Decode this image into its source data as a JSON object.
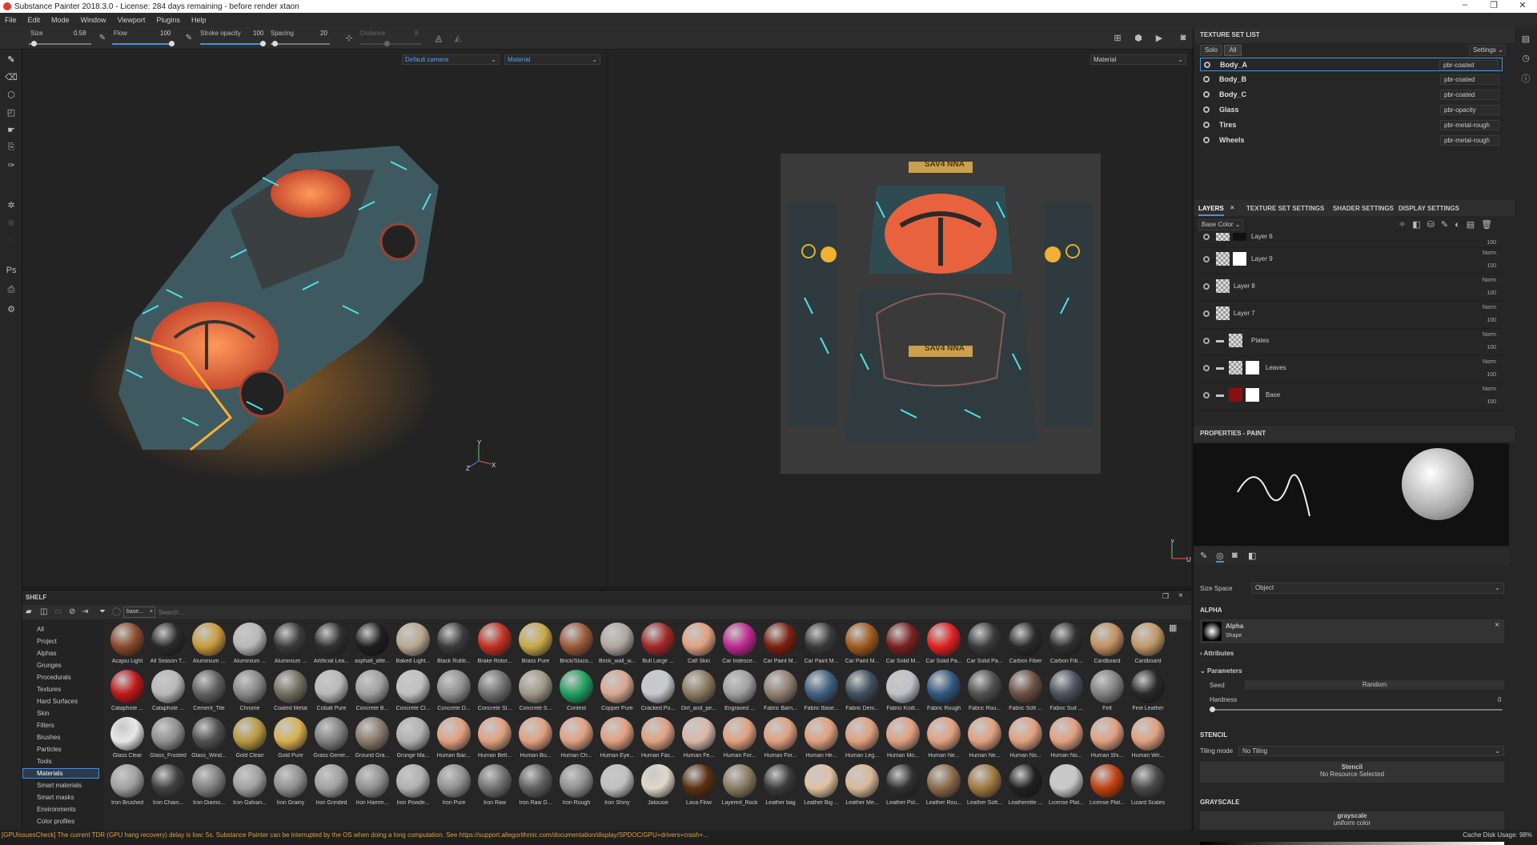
{
  "window": {
    "title": "Substance Painter 2018.3.0 - License: 284 days remaining - before render xtaon"
  },
  "menu": [
    "File",
    "Edit",
    "Mode",
    "Window",
    "Viewport",
    "Plugins",
    "Help"
  ],
  "toolbar": {
    "size_label": "Size",
    "size_value": "0.58",
    "flow_label": "Flow",
    "flow_value": "100",
    "stroke_label": "Stroke opacity",
    "stroke_value": "100",
    "spacing_label": "Spacing",
    "spacing_value": "20",
    "distance_label": "Distance",
    "distance_value": "8"
  },
  "viewport3d": {
    "camera": "Default camera",
    "mode": "Material"
  },
  "viewport2d": {
    "mode": "Material",
    "plate_text": "SAV4 NNA"
  },
  "texture_set_list": {
    "title": "TEXTURE SET LIST",
    "solo": "Solo",
    "all": "All",
    "settings": "Settings",
    "items": [
      {
        "name": "Body_A",
        "shader": "pbr-coated"
      },
      {
        "name": "Body_B",
        "shader": "pbr-coated"
      },
      {
        "name": "Body_C",
        "shader": "pbr-coated"
      },
      {
        "name": "Glass",
        "shader": "pbr-opacity"
      },
      {
        "name": "Tires",
        "shader": "pbr-metal-rough"
      },
      {
        "name": "Wheels",
        "shader": "pbr-metal-rough"
      }
    ]
  },
  "layers_tabs": [
    "LAYERS",
    "TEXTURE SET SETTINGS",
    "SHADER SETTINGS",
    "DISPLAY SETTINGS"
  ],
  "layers": {
    "channel": "Base Color",
    "items": [
      {
        "name": "Layer 6",
        "blend": "",
        "opacity": "100"
      },
      {
        "name": "Layer 9",
        "blend": "Norm",
        "opacity": "100"
      },
      {
        "name": "Layer 8",
        "blend": "Norm",
        "opacity": "100"
      },
      {
        "name": "Layer 7",
        "blend": "Norm",
        "opacity": "100"
      },
      {
        "name": "Plates",
        "blend": "Norm",
        "opacity": "100"
      },
      {
        "name": "Leaves",
        "blend": "Norm",
        "opacity": "100"
      },
      {
        "name": "Base",
        "blend": "Norm",
        "opacity": "100"
      }
    ]
  },
  "properties": {
    "title": "PROPERTIES - PAINT",
    "size_space_label": "Size Space",
    "size_space_value": "Object",
    "alpha_header": "ALPHA",
    "alpha_name": "Alpha",
    "alpha_sub": "Shape",
    "attributes": "Attributes",
    "parameters": "Parameters",
    "seed_label": "Seed",
    "seed_value": "Random",
    "hardness_label": "Hardness",
    "hardness_value": "0",
    "stencil_header": "STENCIL",
    "tiling_label": "Tiling mode",
    "tiling_value": "No Tiling",
    "stencil_title": "Stencil",
    "stencil_sub": "No Resource Selected",
    "grayscale_header": "GRAYSCALE",
    "grayscale_title": "grayscale",
    "grayscale_sub": "uniform color",
    "grayscale_value": "1"
  },
  "shelf": {
    "title": "SHELF",
    "filter_tag": "base...",
    "search_placeholder": "Search...",
    "categories": [
      "All",
      "Project",
      "Alphas",
      "Grunges",
      "Procedurals",
      "Textures",
      "Hard Surfaces",
      "Skin",
      "Filters",
      "Brushes",
      "Particles",
      "Tools",
      "Materials",
      "Smart materials",
      "Smart masks",
      "Environments",
      "Color profiles"
    ],
    "selected_category": "Materials",
    "materials": [
      {
        "n": "Acajou Light",
        "c": "#8a4a2a"
      },
      {
        "n": "All Season T...",
        "c": "#2a2a2a"
      },
      {
        "n": "Aluminium ...",
        "c": "#c89a3a"
      },
      {
        "n": "Aluminium ...",
        "c": "#b8b8b8"
      },
      {
        "n": "Aluminium ...",
        "c": "#3a3a3a"
      },
      {
        "n": "Artificial Lea...",
        "c": "#303030"
      },
      {
        "n": "asphalt_afte...",
        "c": "#1e1e1e"
      },
      {
        "n": "Baked Light...",
        "c": "#b8a890"
      },
      {
        "n": "Black Rubb...",
        "c": "#3a3a3a"
      },
      {
        "n": "Brake Rotor...",
        "c": "#c03020"
      },
      {
        "n": "Brass Pure",
        "c": "#c8a848"
      },
      {
        "n": "Brick/Stuco...",
        "c": "#9a5a3a"
      },
      {
        "n": "Brick_wall_w...",
        "c": "#b0a8a0"
      },
      {
        "n": "Bull Large ...",
        "c": "#a02828"
      },
      {
        "n": "Calf Skin",
        "c": "#e0a080"
      },
      {
        "n": "Car Iridesce...",
        "c": "#c02890"
      },
      {
        "n": "Car Paint M...",
        "c": "#7a2010"
      },
      {
        "n": "Car Paint M...",
        "c": "#3a3a3a"
      },
      {
        "n": "Car Paint M...",
        "c": "#a05a20"
      },
      {
        "n": "Car Solid M...",
        "c": "#7a2020"
      },
      {
        "n": "Car Solid Pa...",
        "c": "#e02020"
      },
      {
        "n": "Car Solid Pa...",
        "c": "#3a3a3a"
      },
      {
        "n": "Carbon Fiber",
        "c": "#2a2a2a"
      },
      {
        "n": "Carbon Fib...",
        "c": "#303030"
      },
      {
        "n": "Cardboard",
        "c": "#c09060"
      },
      {
        "n": "Cardboard",
        "c": "#c09868"
      },
      {
        "n": "Cataphote ...",
        "c": "#c01818"
      },
      {
        "n": "Cataphote ...",
        "c": "#b8b8b8"
      },
      {
        "n": "Cement_Tile",
        "c": "#606060"
      },
      {
        "n": "Chrome",
        "c": "#888"
      },
      {
        "n": "Coated Metal",
        "c": "#707060"
      },
      {
        "n": "Cobalt Pure",
        "c": "#b8b8b8"
      },
      {
        "n": "Concrete B...",
        "c": "#a0a0a0"
      },
      {
        "n": "Concrete Cl...",
        "c": "#c0c0c0"
      },
      {
        "n": "Concrete D...",
        "c": "#909090"
      },
      {
        "n": "Concrete Sl...",
        "c": "#707070"
      },
      {
        "n": "Concrete S...",
        "c": "#a09888"
      },
      {
        "n": "Contest",
        "c": "#20a060"
      },
      {
        "n": "Copper Pure",
        "c": "#d8a890"
      },
      {
        "n": "Cracked Po...",
        "c": "#c8c8d0"
      },
      {
        "n": "Dirt_and_pe...",
        "c": "#8a7a60"
      },
      {
        "n": "Engraved ...",
        "c": "#a0a0a0"
      },
      {
        "n": "Fabric Barn...",
        "c": "#908070"
      },
      {
        "n": "Fabric Base...",
        "c": "#406080"
      },
      {
        "n": "Fabric Deni...",
        "c": "#405060"
      },
      {
        "n": "Fabric Knitt...",
        "c": "#c0c0c8"
      },
      {
        "n": "Fabric Rough",
        "c": "#305880"
      },
      {
        "n": "Fabric Rou...",
        "c": "#505050"
      },
      {
        "n": "Fabric Soft ...",
        "c": "#6a5040"
      },
      {
        "n": "Fabric Suit ...",
        "c": "#505060"
      },
      {
        "n": "Felt",
        "c": "#808080"
      },
      {
        "n": "Fine Leather",
        "c": "#282828"
      },
      {
        "n": "Glass Clear",
        "c": "#e8e8e8"
      },
      {
        "n": "Glass_Frosted",
        "c": "#909090"
      },
      {
        "n": "Glass_Wind...",
        "c": "#505050"
      },
      {
        "n": "Gold Clean",
        "c": "#b89840"
      },
      {
        "n": "Gold Pure",
        "c": "#d8b050"
      },
      {
        "n": "Grass Gener...",
        "c": "#808080"
      },
      {
        "n": "Ground Gra...",
        "c": "#8a7a6a"
      },
      {
        "n": "Grunge Ma...",
        "c": "#b0b0b0"
      },
      {
        "n": "Human Bac...",
        "c": "#e0a080"
      },
      {
        "n": "Human Bell...",
        "c": "#e0a080"
      },
      {
        "n": "Human Bu...",
        "c": "#e0a080"
      },
      {
        "n": "Human Ch...",
        "c": "#e0a080"
      },
      {
        "n": "Human Eye...",
        "c": "#e0a080"
      },
      {
        "n": "Human Fac...",
        "c": "#e0a080"
      },
      {
        "n": "Human Fe...",
        "c": "#d8b8a8"
      },
      {
        "n": "Human For...",
        "c": "#e0a080"
      },
      {
        "n": "Human For...",
        "c": "#e0a080"
      },
      {
        "n": "Human He...",
        "c": "#e0a080"
      },
      {
        "n": "Human Leg...",
        "c": "#e0a080"
      },
      {
        "n": "Human Mo...",
        "c": "#e0a080"
      },
      {
        "n": "Human Ne...",
        "c": "#e0a080"
      },
      {
        "n": "Human Ne...",
        "c": "#e0a080"
      },
      {
        "n": "Human No...",
        "c": "#e0a080"
      },
      {
        "n": "Human No...",
        "c": "#e0a080"
      },
      {
        "n": "Human Shi...",
        "c": "#e0a080"
      },
      {
        "n": "Human Wri...",
        "c": "#e0a080"
      },
      {
        "n": "Iron Brushed",
        "c": "#a0a0a0"
      },
      {
        "n": "Iron Chain...",
        "c": "#404040"
      },
      {
        "n": "Iron Diamo...",
        "c": "#808080"
      },
      {
        "n": "Iron Galvan...",
        "c": "#a0a0a0"
      },
      {
        "n": "Iron Grainy",
        "c": "#909090"
      },
      {
        "n": "Iron Grinded",
        "c": "#a0a0a0"
      },
      {
        "n": "Iron Hamm...",
        "c": "#909090"
      },
      {
        "n": "Iron Powde...",
        "c": "#b0b0b0"
      },
      {
        "n": "Iron Pure",
        "c": "#909090"
      },
      {
        "n": "Iron Raw",
        "c": "#707070"
      },
      {
        "n": "Iron Raw D...",
        "c": "#606060"
      },
      {
        "n": "Iron Rough",
        "c": "#909090"
      },
      {
        "n": "Iron Shiny",
        "c": "#c0c0c0"
      },
      {
        "n": "Jalousie",
        "c": "#e0d8c8"
      },
      {
        "n": "Lava Flow",
        "c": "#5a3010"
      },
      {
        "n": "Layered_Rock",
        "c": "#8a7a60"
      },
      {
        "n": "Leather bag",
        "c": "#3a3a3a"
      },
      {
        "n": "Leather Big ...",
        "c": "#e0c0a0"
      },
      {
        "n": "Leather Me...",
        "c": "#d8b898"
      },
      {
        "n": "Leather Pol...",
        "c": "#303030"
      },
      {
        "n": "Leather Rou...",
        "c": "#8a6a4a"
      },
      {
        "n": "Leather Soft...",
        "c": "#a07840"
      },
      {
        "n": "Leatherette ...",
        "c": "#202020"
      },
      {
        "n": "License Plat...",
        "c": "#c8c8c8"
      },
      {
        "n": "License Plat...",
        "c": "#c04010"
      },
      {
        "n": "Lizard Scales",
        "c": "#484848"
      }
    ]
  },
  "status": {
    "message": "[GPUIssuesCheck] The current TDR (GPU hang recovery) delay is low: 5s. Substance Painter can be interrupted by the OS when doing a long computation. See https://support.allegorithmic.com/documentation/display/SPDOC/GPU+drivers+crash+...",
    "cache": "Cache Disk Usage:   98%"
  }
}
